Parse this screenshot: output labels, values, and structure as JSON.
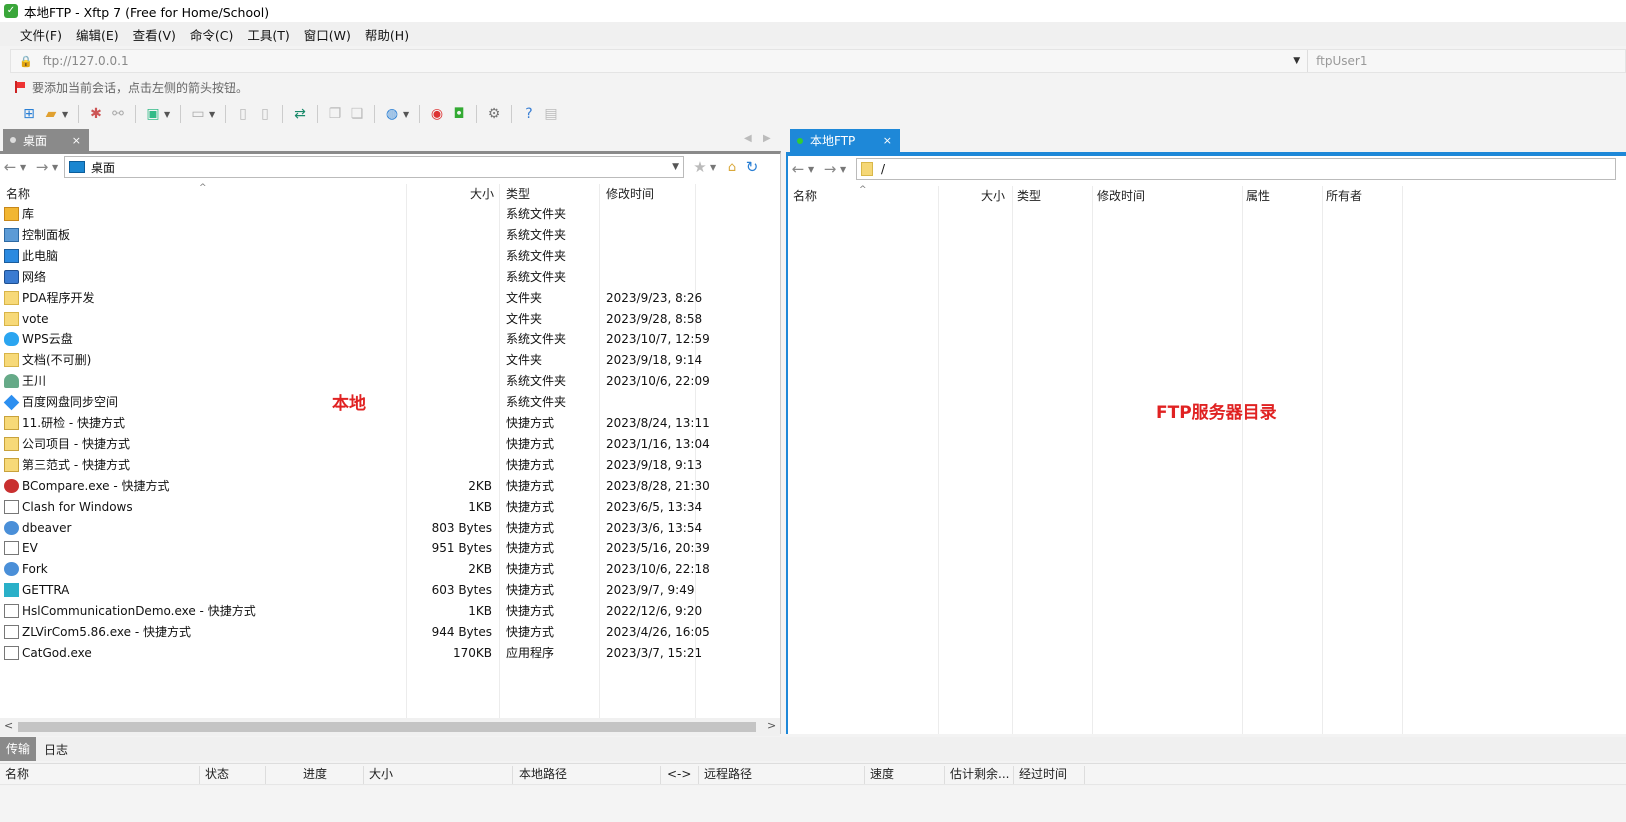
{
  "window": {
    "title": "本地FTP - Xftp 7 (Free for Home/School)"
  },
  "menu": [
    "文件(F)",
    "编辑(E)",
    "查看(V)",
    "命令(C)",
    "工具(T)",
    "窗口(W)",
    "帮助(H)"
  ],
  "address": {
    "value": "ftp://127.0.0.1",
    "user": "ftpUser1"
  },
  "hint": "要添加当前会话，点击左侧的箭头按钮。",
  "tabs": {
    "left": {
      "label": "桌面",
      "close": "×"
    },
    "right": {
      "label": "本地FTP",
      "close": "×"
    }
  },
  "left_pane": {
    "path": "桌面",
    "columns": [
      "名称",
      "大小",
      "类型",
      "修改时间"
    ],
    "annotation": "本地",
    "rows": [
      {
        "name": "库",
        "size": "",
        "type": "系统文件夹",
        "modified": ""
      },
      {
        "name": "控制面板",
        "size": "",
        "type": "系统文件夹",
        "modified": ""
      },
      {
        "name": "此电脑",
        "size": "",
        "type": "系统文件夹",
        "modified": ""
      },
      {
        "name": "网络",
        "size": "",
        "type": "系统文件夹",
        "modified": ""
      },
      {
        "name": "PDA程序开发",
        "size": "",
        "type": "文件夹",
        "modified": "2023/9/23, 8:26"
      },
      {
        "name": "vote",
        "size": "",
        "type": "文件夹",
        "modified": "2023/9/28, 8:58"
      },
      {
        "name": "WPS云盘",
        "size": "",
        "type": "系统文件夹",
        "modified": "2023/10/7, 12:59"
      },
      {
        "name": "文档(不可删)",
        "size": "",
        "type": "文件夹",
        "modified": "2023/9/18, 9:14"
      },
      {
        "name": "王川",
        "size": "",
        "type": "系统文件夹",
        "modified": "2023/10/6, 22:09"
      },
      {
        "name": "百度网盘同步空间",
        "size": "",
        "type": "系统文件夹",
        "modified": ""
      },
      {
        "name": "11.研检 - 快捷方式",
        "size": "",
        "type": "快捷方式",
        "modified": "2023/8/24, 13:11"
      },
      {
        "name": "公司项目 - 快捷方式",
        "size": "",
        "type": "快捷方式",
        "modified": "2023/1/16, 13:04"
      },
      {
        "name": "第三范式 - 快捷方式",
        "size": "",
        "type": "快捷方式",
        "modified": "2023/9/18, 9:13"
      },
      {
        "name": "BCompare.exe - 快捷方式",
        "size": "2KB",
        "type": "快捷方式",
        "modified": "2023/8/28, 21:30"
      },
      {
        "name": "Clash for Windows",
        "size": "1KB",
        "type": "快捷方式",
        "modified": "2023/6/5, 13:34"
      },
      {
        "name": "dbeaver",
        "size": "803 Bytes",
        "type": "快捷方式",
        "modified": "2023/3/6, 13:54"
      },
      {
        "name": "EV",
        "size": "951 Bytes",
        "type": "快捷方式",
        "modified": "2023/5/16, 20:39"
      },
      {
        "name": "Fork",
        "size": "2KB",
        "type": "快捷方式",
        "modified": "2023/10/6, 22:18"
      },
      {
        "name": "GETTRA",
        "size": "603 Bytes",
        "type": "快捷方式",
        "modified": "2023/9/7, 9:49"
      },
      {
        "name": "HslCommunicationDemo.exe - 快捷方式",
        "size": "1KB",
        "type": "快捷方式",
        "modified": "2022/12/6, 9:20"
      },
      {
        "name": "ZLVirCom5.86.exe - 快捷方式",
        "size": "944 Bytes",
        "type": "快捷方式",
        "modified": "2023/4/26, 16:05"
      },
      {
        "name": "CatGod.exe",
        "size": "170KB",
        "type": "应用程序",
        "modified": "2023/3/7, 15:21"
      }
    ]
  },
  "right_pane": {
    "path": "/",
    "columns": [
      "名称",
      "大小",
      "类型",
      "修改时间",
      "属性",
      "所有者"
    ],
    "annotation": "FTP服务器目录"
  },
  "bottom": {
    "tabs": [
      "传输",
      "日志"
    ],
    "columns": [
      "名称",
      "状态",
      "进度",
      "大小",
      "本地路径",
      "<->",
      "远程路径",
      "速度",
      "估计剩余...",
      "经过时间"
    ]
  }
}
